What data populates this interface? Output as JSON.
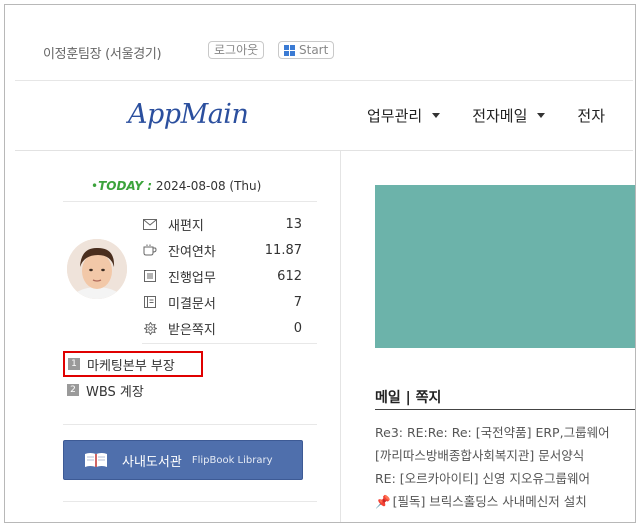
{
  "user": {
    "name": "이정훈팀장 (서울경기)",
    "logout_label": "로그아웃",
    "start_label": "Start"
  },
  "header": {
    "logo": "AppMain",
    "nav": [
      {
        "label": "업무관리"
      },
      {
        "label": "전자메일"
      },
      {
        "label": "전자"
      }
    ]
  },
  "today": {
    "label": "TODAY",
    "date": "2024-08-08 (Thu)"
  },
  "stats": [
    {
      "icon": "envelope-icon",
      "label": "새편지",
      "value": "13"
    },
    {
      "icon": "cup-icon",
      "label": "잔여연차",
      "value": "11.87"
    },
    {
      "icon": "list-icon",
      "label": "진행업무",
      "value": "612"
    },
    {
      "icon": "document-icon",
      "label": "미결문서",
      "value": "7"
    },
    {
      "icon": "gear-icon",
      "label": "받은쪽지",
      "value": "0"
    }
  ],
  "roles": [
    {
      "num": "1",
      "label": "마케팅본부 부장",
      "active": true
    },
    {
      "num": "2",
      "label": "WBS 계장",
      "active": false
    }
  ],
  "library": {
    "label": "사내도서관",
    "sub": "FlipBook Library"
  },
  "mail": {
    "title": "메일 | 쪽지",
    "items": [
      "Re3: RE:Re: Re: [국전약품] ERP,그룹웨어",
      "[까리따스방배종합사회복지관] 문서양식",
      "RE: [오르카아이티] 신영 지오유그룹웨어",
      "[필독] 브릭스홀딩스 사내메신저 설치"
    ]
  },
  "colors": {
    "logo": "#2b4f9e",
    "banner": "#6cb3aa",
    "library_button": "#4f6fac",
    "highlight_border": "#e00000",
    "today_green": "#3ca33c"
  }
}
